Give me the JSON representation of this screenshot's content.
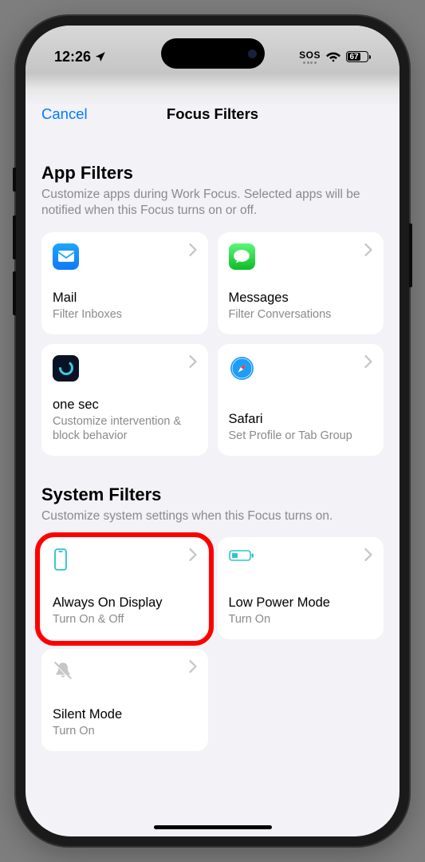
{
  "status": {
    "time": "12:26",
    "sos": "SOS",
    "battery": "67"
  },
  "header": {
    "cancel": "Cancel",
    "title": "Focus Filters"
  },
  "sections": {
    "app": {
      "title": "App Filters",
      "desc": "Customize apps during Work Focus. Selected apps will be notified when this Focus turns on or off."
    },
    "system": {
      "title": "System Filters",
      "desc": "Customize system settings when this Focus turns on."
    }
  },
  "cards": {
    "mail": {
      "title": "Mail",
      "sub": "Filter Inboxes"
    },
    "messages": {
      "title": "Messages",
      "sub": "Filter Conversations"
    },
    "onesec": {
      "title": "one sec",
      "sub": "Customize intervention & block behavior"
    },
    "safari": {
      "title": "Safari",
      "sub": "Set Profile or Tab Group"
    },
    "aod": {
      "title": "Always On Display",
      "sub": "Turn On & Off"
    },
    "lowpower": {
      "title": "Low Power Mode",
      "sub": "Turn On"
    },
    "silent": {
      "title": "Silent Mode",
      "sub": "Turn On"
    }
  }
}
